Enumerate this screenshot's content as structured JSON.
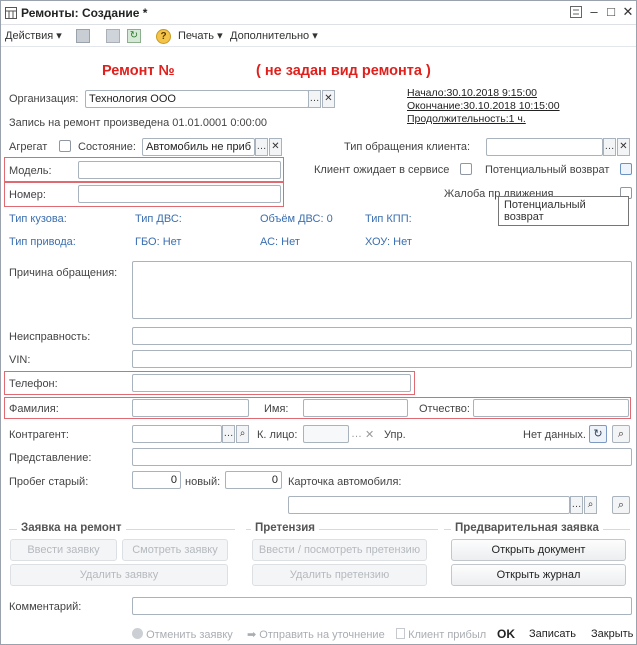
{
  "window": {
    "title": "Ремонты: Создание *"
  },
  "toolbar": {
    "actions": "Действия",
    "print": "Печать",
    "more": "Дополнительно"
  },
  "header": {
    "repair_title": "Ремонт №",
    "repair_kind": "( не задан вид ремонта )",
    "start": "Начало:30.10.2018 9:15:00",
    "end": "Окончание:30.10.2018 10:15:00",
    "duration": "Продолжительность:1 ч."
  },
  "form": {
    "org_label": "Организация:",
    "org_value": "Технология ООО",
    "record_text": "Запись на ремонт произведена 01.01.0001 0:00:00",
    "aggregate_label": "Агрегат",
    "state_label": "Состояние:",
    "state_value": "Автомобиль не приб",
    "request_type_label": "Тип обращения клиента:",
    "model_label": "Модель:",
    "number_label": "Номер:",
    "client_waits_label": "Клиент ожидает в сервисе",
    "potential_return_label": "Потенциальный возврат",
    "complaint_label": "Жалоба пр   движения",
    "tooltip": "Потенциальный возврат",
    "body_type": "Тип кузова:",
    "engine_type": "Тип ДВС:",
    "engine_volume": "Объём ДВС: 0",
    "gearbox_type": "Тип КПП:",
    "drive_type": "Тип привода:",
    "gbo": "ГБО: Нет",
    "ac": "АС: Нет",
    "hou": "ХОУ: Нет",
    "reason_label": "Причина обращения:",
    "fault_label": "Неисправность:",
    "vin_label": "VIN:",
    "phone_label": "Телефон:",
    "surname_label": "Фамилия:",
    "name_label": "Имя:",
    "patronymic_label": "Отчество:",
    "counterparty_label": "Контрагент:",
    "contact_label": "К. лицо:",
    "upr_label": "Упр.",
    "no_data": "Нет данных.",
    "representative_label": "Представление:",
    "mileage_old_label": "Пробег старый:",
    "mileage_old": "0",
    "mileage_new_label": "новый:",
    "mileage_new": "0",
    "car_card_label": "Карточка автомобиля:",
    "comment_label": "Комментарий:"
  },
  "groups": {
    "request": {
      "title": "Заявка на ремонт",
      "enter": "Ввести заявку",
      "view": "Смотреть заявку",
      "delete": "Удалить заявку"
    },
    "claim": {
      "title": "Претензия",
      "enter": "Ввести / посмотреть претензию",
      "delete": "Удалить претензию"
    },
    "prelim": {
      "title": "Предварительная заявка",
      "open_doc": "Открыть документ",
      "open_journal": "Открыть журнал"
    }
  },
  "footer": {
    "cancel": "Отменить заявку",
    "send": "Отправить на уточнение",
    "arrived": "Клиент прибыл",
    "ok": "OK",
    "save": "Записать",
    "close": "Закрыть"
  },
  "colors": {
    "accent_red": "#e0201c",
    "link_blue": "#3a6fb0",
    "highlight_box": "#e06a72"
  }
}
